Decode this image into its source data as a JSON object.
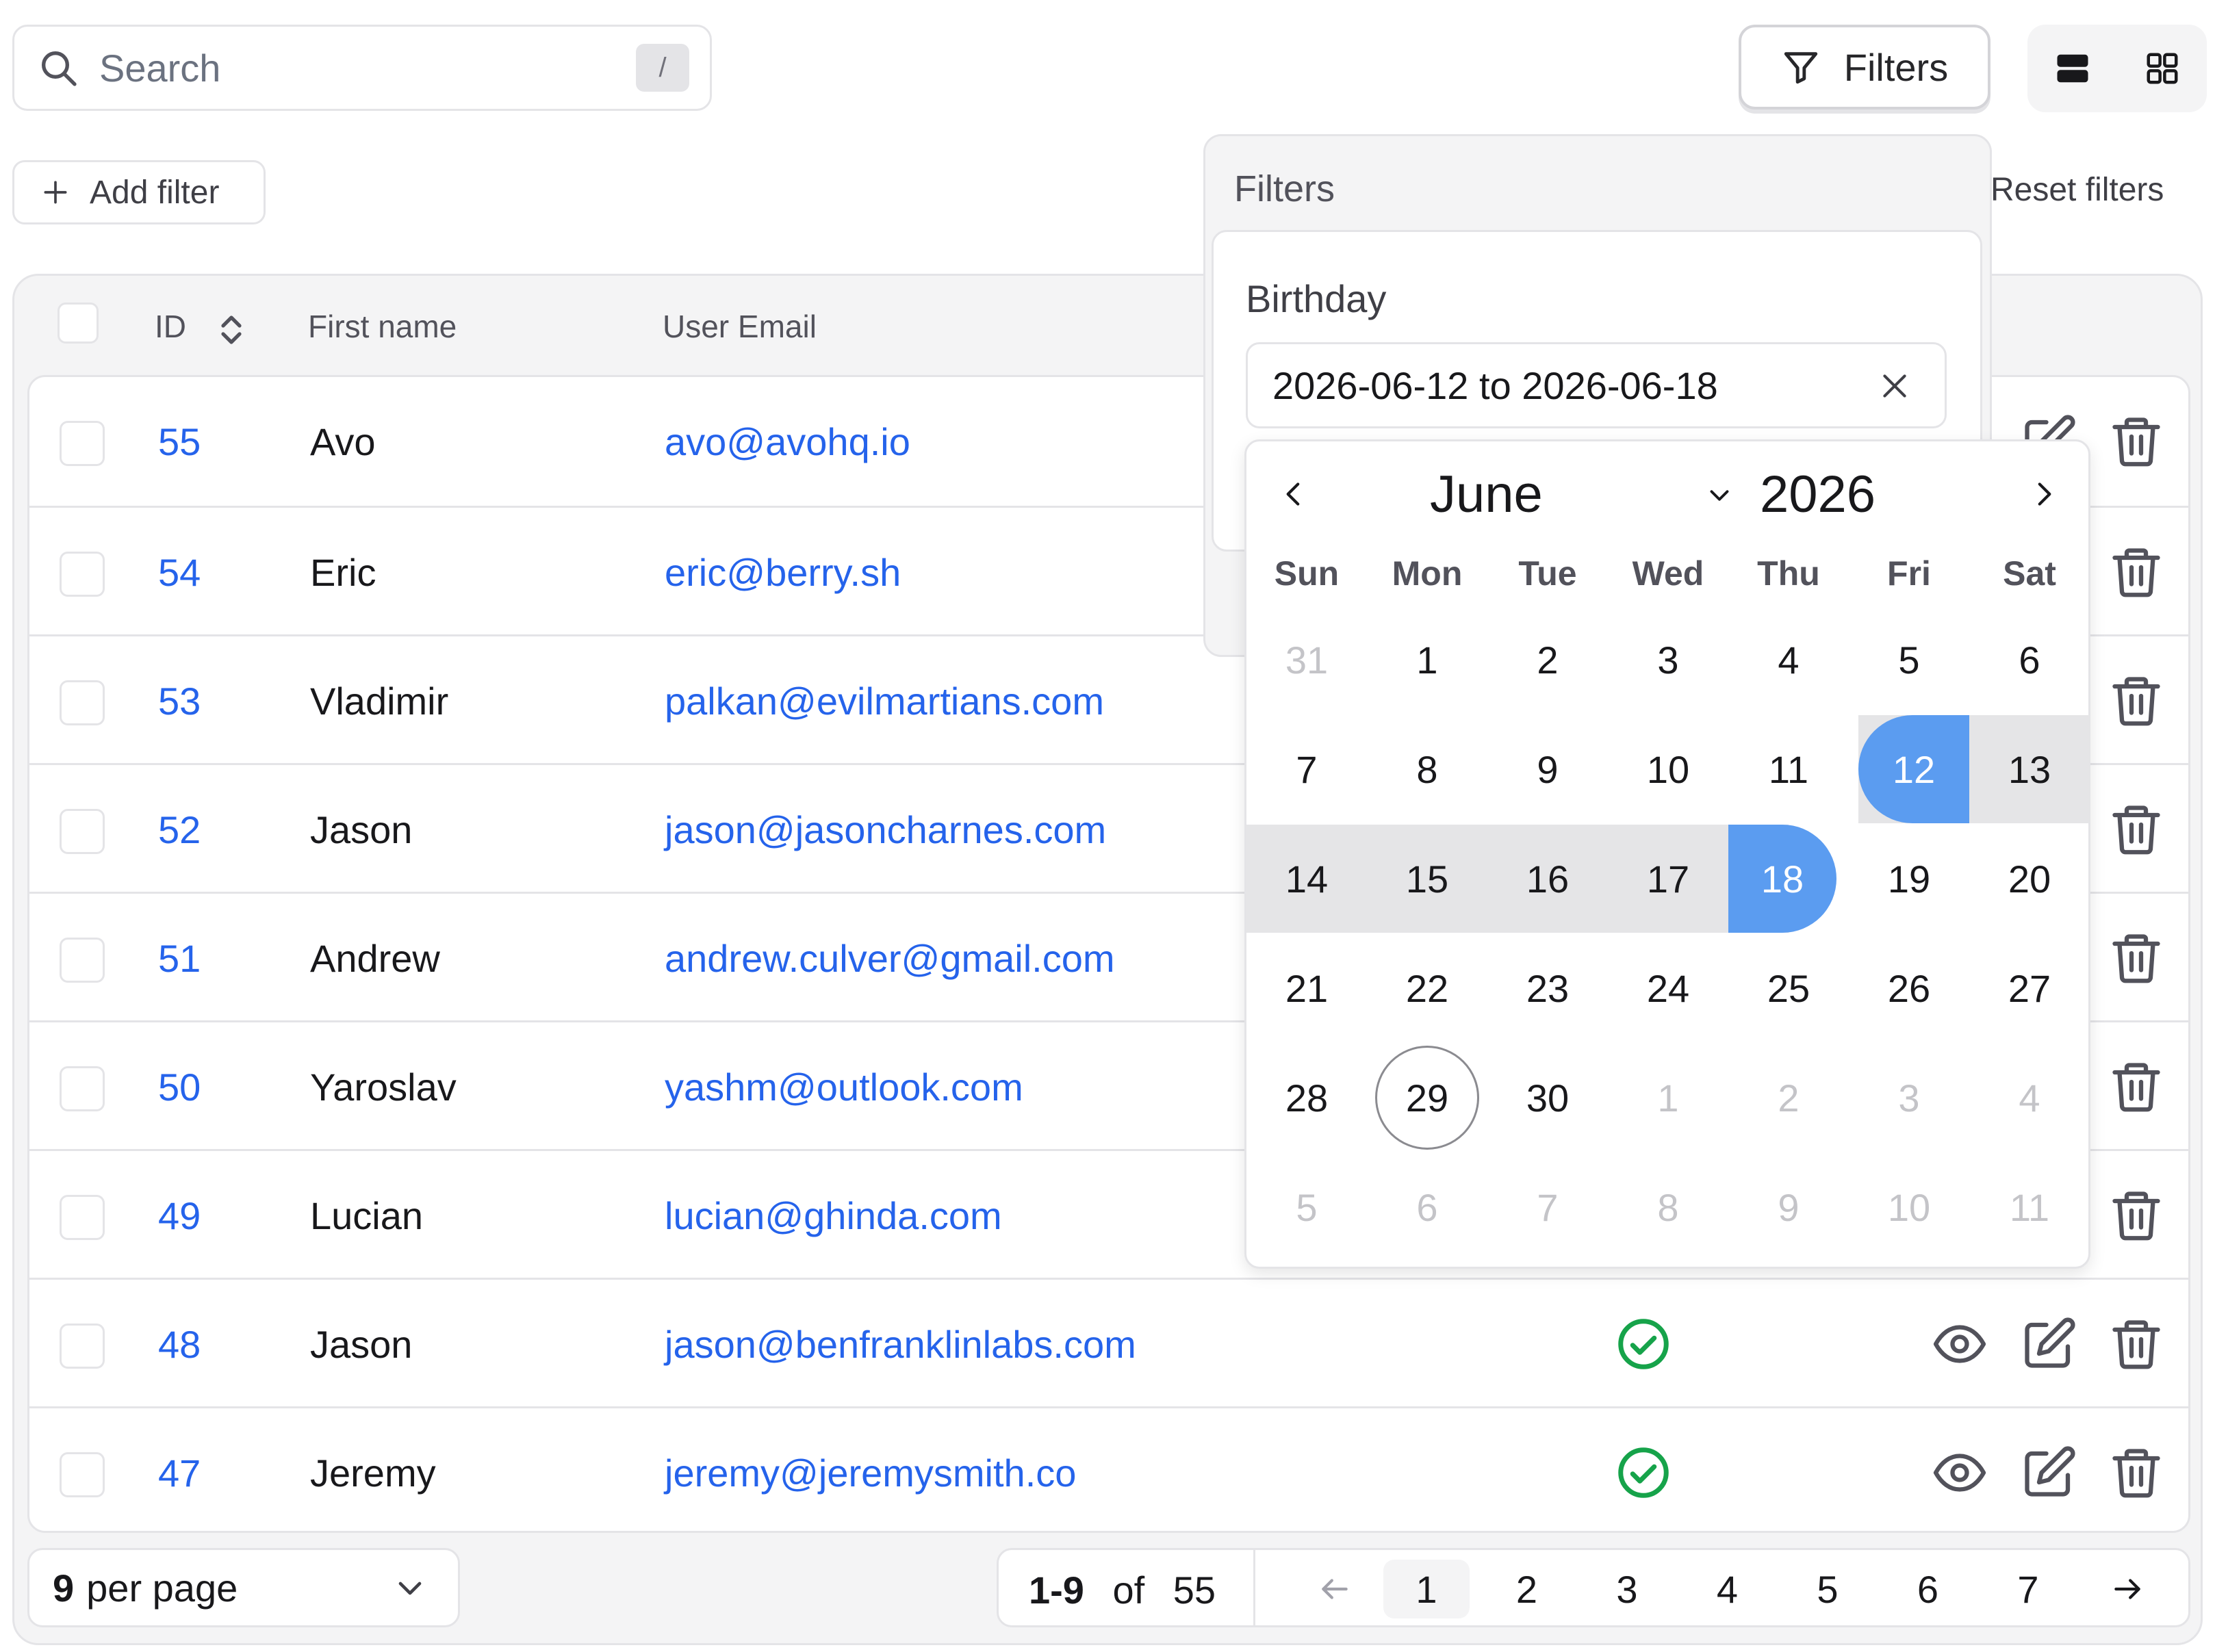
{
  "search": {
    "placeholder": "Search",
    "shortcut": "/"
  },
  "toolbar": {
    "filters_label": "Filters",
    "add_filter_label": "Add filter",
    "reset_filters_label": "Reset filters"
  },
  "table": {
    "headers": {
      "id": "ID",
      "first_name": "First name",
      "email": "User Email"
    },
    "rows": [
      {
        "id": "55",
        "first_name": "Avo",
        "email": "avo@avohq.io"
      },
      {
        "id": "54",
        "first_name": "Eric",
        "email": "eric@berry.sh"
      },
      {
        "id": "53",
        "first_name": "Vladimir",
        "email": "palkan@evilmartians.com"
      },
      {
        "id": "52",
        "first_name": "Jason",
        "email": "jason@jasoncharnes.com"
      },
      {
        "id": "51",
        "first_name": "Andrew",
        "email": "andrew.culver@gmail.com"
      },
      {
        "id": "50",
        "first_name": "Yaroslav",
        "email": "yashm@outlook.com"
      },
      {
        "id": "49",
        "first_name": "Lucian",
        "email": "lucian@ghinda.com"
      },
      {
        "id": "48",
        "first_name": "Jason",
        "email": "jason@benfranklinlabs.com",
        "active": true
      },
      {
        "id": "47",
        "first_name": "Jeremy",
        "email": "jeremy@jeremysmith.co",
        "active": true
      }
    ]
  },
  "pagination": {
    "per_page_value": "9",
    "per_page_suffix": "per page",
    "range": "1-9",
    "of": "of",
    "total": "55",
    "pages": [
      "1",
      "2",
      "3",
      "4",
      "5",
      "6",
      "7"
    ],
    "current_page": "1"
  },
  "filters_panel": {
    "title": "Filters",
    "birthday_label": "Birthday",
    "date_range_value": "2026-06-12 to 2026-06-18"
  },
  "calendar": {
    "month": "June",
    "year": "2026",
    "weekdays": [
      "Sun",
      "Mon",
      "Tue",
      "Wed",
      "Thu",
      "Fri",
      "Sat"
    ],
    "weeks": [
      [
        "31",
        "1",
        "2",
        "3",
        "4",
        "5",
        "6"
      ],
      [
        "7",
        "8",
        "9",
        "10",
        "11",
        "12",
        "13"
      ],
      [
        "14",
        "15",
        "16",
        "17",
        "18",
        "19",
        "20"
      ],
      [
        "21",
        "22",
        "23",
        "24",
        "25",
        "26",
        "27"
      ],
      [
        "28",
        "29",
        "30",
        "1",
        "2",
        "3",
        "4"
      ],
      [
        "5",
        "6",
        "7",
        "8",
        "9",
        "10",
        "11"
      ]
    ],
    "range_start": "12",
    "range_end": "18",
    "today": "29"
  },
  "colors": {
    "accent": "#2563eb",
    "selected_day": "#5b9cf0",
    "success": "#16a34a",
    "border": "#e4e4e7"
  }
}
